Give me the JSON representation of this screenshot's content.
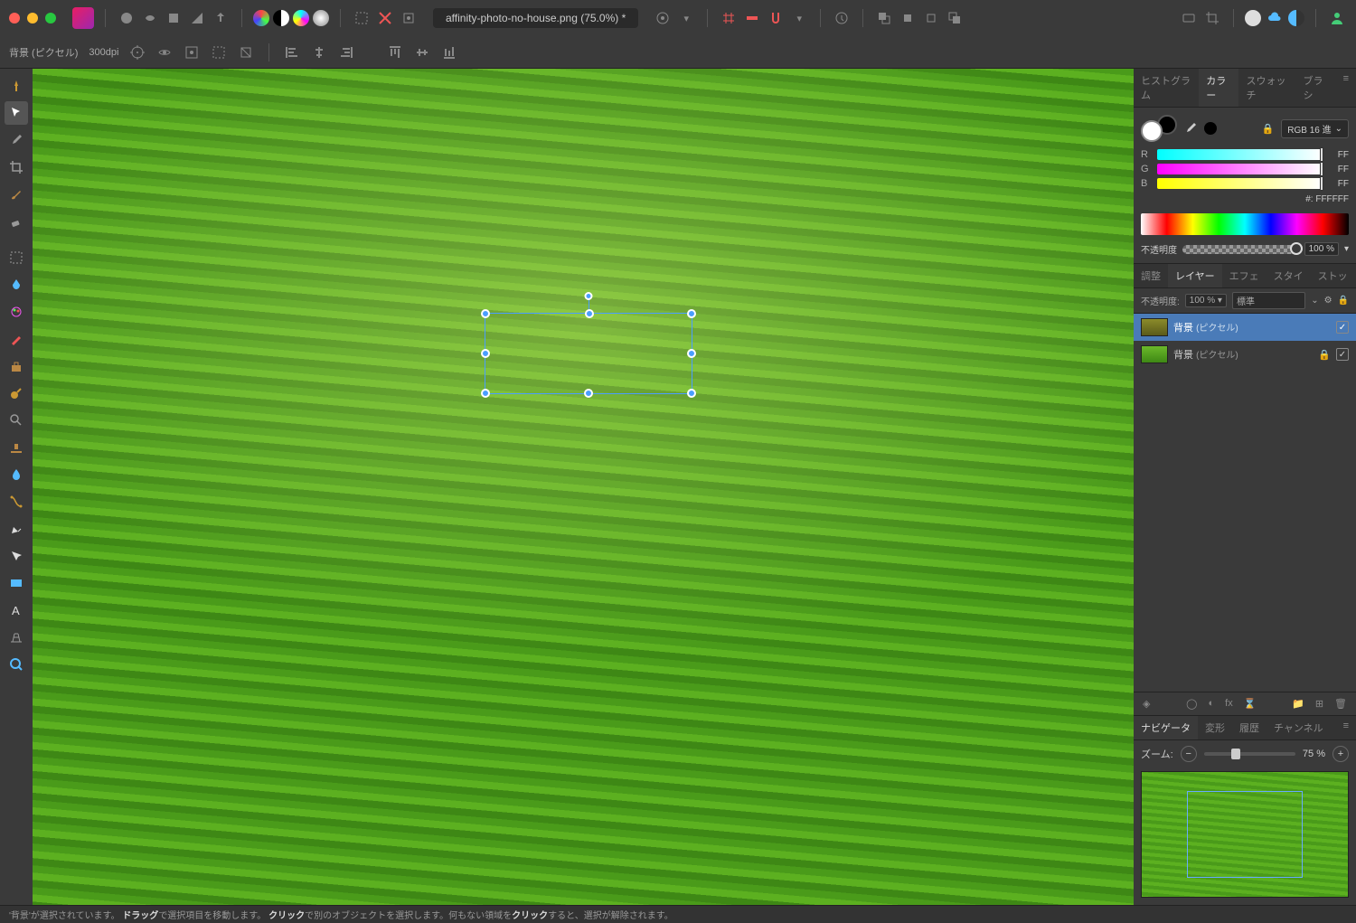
{
  "document": {
    "title": "affinity-photo-no-house.png (75.0%)",
    "modified": "*"
  },
  "contextbar": {
    "layer_label": "背景 (ピクセル)",
    "dpi": "300dpi"
  },
  "color_panel": {
    "tabs": [
      "ヒストグラム",
      "カラー",
      "スウォッチ",
      "ブラシ"
    ],
    "active_tab": "カラー",
    "mode": "RGB 16 進",
    "r": "FF",
    "g": "FF",
    "b": "FF",
    "hex_label": "#:",
    "hex": "FFFFFF",
    "opacity_label": "不透明度",
    "opacity_value": "100 %"
  },
  "layers_panel": {
    "tabs": [
      "調整",
      "レイヤー",
      "エフェ",
      "スタイ",
      "ストッ"
    ],
    "active_tab": "レイヤー",
    "opacity_label": "不透明度:",
    "opacity_value": "100 %",
    "blend_mode": "標準",
    "layers": [
      {
        "name": "背景",
        "type": "(ピクセル)",
        "selected": true,
        "visible": true,
        "locked": false
      },
      {
        "name": "背景",
        "type": "(ピクセル)",
        "selected": false,
        "visible": true,
        "locked": true
      }
    ]
  },
  "navigator": {
    "tabs": [
      "ナビゲータ",
      "変形",
      "履歴",
      "チャンネル"
    ],
    "active_tab": "ナビゲータ",
    "zoom_label": "ズーム:",
    "zoom_value": "75 %"
  },
  "status": {
    "prefix": "'背景'が選択されています。",
    "b1": "ドラッグ",
    "t1": "で選択項目を移動します。",
    "b2": "クリック",
    "t2": "で別のオブジェクトを選択します。何もない領域を",
    "b3": "クリック",
    "t3": "すると、選択が解除されます。"
  }
}
